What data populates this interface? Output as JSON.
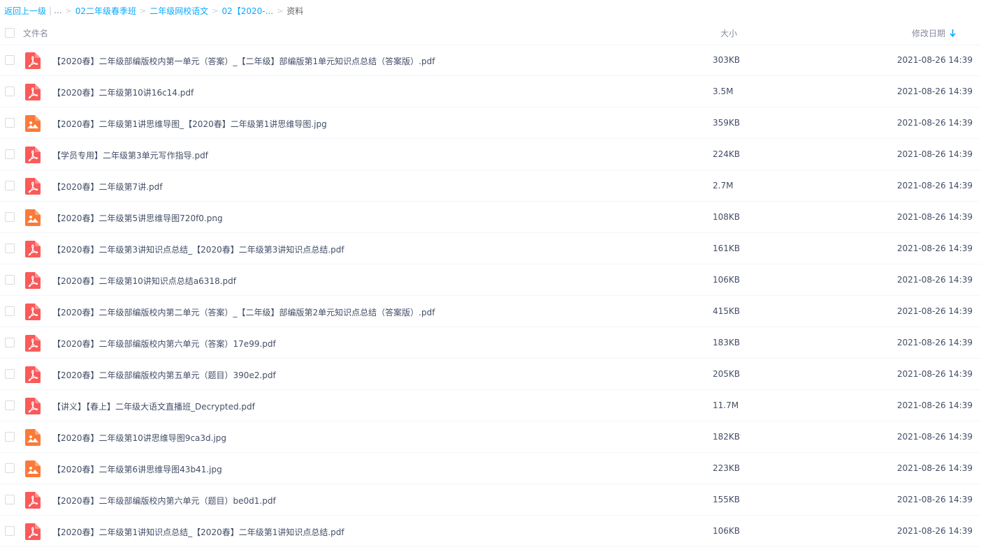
{
  "breadcrumb": {
    "back": "返回上一级",
    "ellipsis": "...",
    "items": [
      "02二年级春季班",
      "二年级网校语文",
      "02【2020-..."
    ],
    "current": "资料"
  },
  "header": {
    "name": "文件名",
    "size": "大小",
    "date": "修改日期"
  },
  "colors": {
    "link": "#09aaff",
    "pdf_icon": "#fa5a5a",
    "image_icon": "#fa7a3a",
    "text": "#424e67"
  },
  "files": [
    {
      "name": "【2020春】二年级部编版校内第一单元（答案）_【二年级】部编版第1单元知识点总结（答案版）.pdf",
      "size": "303KB",
      "date": "2021-08-26 14:39",
      "icon": "pdf-icon"
    },
    {
      "name": "【2020春】二年级第10讲16c14.pdf",
      "size": "3.5M",
      "date": "2021-08-26 14:39",
      "icon": "pdf-icon"
    },
    {
      "name": "【2020春】二年级第1讲思维导图_【2020春】二年级第1讲思维导图.jpg",
      "size": "359KB",
      "date": "2021-08-26 14:39",
      "icon": "image-icon"
    },
    {
      "name": "【学员专用】二年级第3单元写作指导.pdf",
      "size": "224KB",
      "date": "2021-08-26 14:39",
      "icon": "pdf-icon"
    },
    {
      "name": "【2020春】二年级第7讲.pdf",
      "size": "2.7M",
      "date": "2021-08-26 14:39",
      "icon": "pdf-icon"
    },
    {
      "name": "【2020春】二年级第5讲思维导图720f0.png",
      "size": "108KB",
      "date": "2021-08-26 14:39",
      "icon": "image-icon"
    },
    {
      "name": "【2020春】二年级第3讲知识点总结_【2020春】二年级第3讲知识点总结.pdf",
      "size": "161KB",
      "date": "2021-08-26 14:39",
      "icon": "pdf-icon"
    },
    {
      "name": "【2020春】二年级第10讲知识点总结a6318.pdf",
      "size": "106KB",
      "date": "2021-08-26 14:39",
      "icon": "pdf-icon"
    },
    {
      "name": "【2020春】二年级部编版校内第二单元（答案）_【二年级】部编版第2单元知识点总结（答案版）.pdf",
      "size": "415KB",
      "date": "2021-08-26 14:39",
      "icon": "pdf-icon"
    },
    {
      "name": "【2020春】二年级部编版校内第六单元（答案）17e99.pdf",
      "size": "183KB",
      "date": "2021-08-26 14:39",
      "icon": "pdf-icon"
    },
    {
      "name": "【2020春】二年级部编版校内第五单元（题目）390e2.pdf",
      "size": "205KB",
      "date": "2021-08-26 14:39",
      "icon": "pdf-icon"
    },
    {
      "name": "【讲义】【春上】二年级大语文直播班_Decrypted.pdf",
      "size": "11.7M",
      "date": "2021-08-26 14:39",
      "icon": "pdf-icon"
    },
    {
      "name": "【2020春】二年级第10讲思维导图9ca3d.jpg",
      "size": "182KB",
      "date": "2021-08-26 14:39",
      "icon": "image-icon"
    },
    {
      "name": "【2020春】二年级第6讲思维导图43b41.jpg",
      "size": "223KB",
      "date": "2021-08-26 14:39",
      "icon": "image-icon"
    },
    {
      "name": "【2020春】二年级部编版校内第六单元（题目）be0d1.pdf",
      "size": "155KB",
      "date": "2021-08-26 14:39",
      "icon": "pdf-icon"
    },
    {
      "name": "【2020春】二年级第1讲知识点总结_【2020春】二年级第1讲知识点总结.pdf",
      "size": "106KB",
      "date": "2021-08-26 14:39",
      "icon": "pdf-icon"
    }
  ]
}
